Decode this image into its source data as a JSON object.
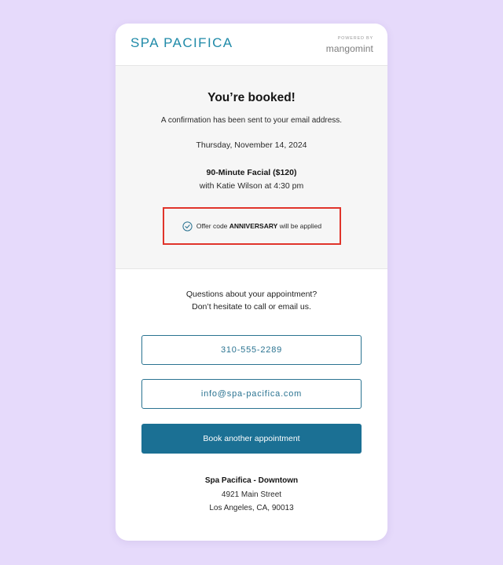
{
  "header": {
    "logo": "SPA PACIFICA",
    "powered_by": "POWERED BY",
    "platform": "mangomint"
  },
  "confirmation": {
    "title": "You’re booked!",
    "subtitle": "A confirmation has been sent to your email address.",
    "date": "Thursday, November 14, 2024",
    "service": "90-Minute Facial ($120)",
    "provider": "with Katie Wilson at 4:30 pm",
    "offer": {
      "prefix": "Offer code ",
      "code": "ANNIVERSARY",
      "suffix": " will be applied",
      "icon": "check-circle-icon",
      "highlight_color": "#e0342b"
    }
  },
  "contact": {
    "question_line1": "Questions about your appointment?",
    "question_line2": "Don’t hesitate to call or email us.",
    "phone": "310-555-2289",
    "email": "info@spa-pacifica.com",
    "book_label": "Book another appointment"
  },
  "location": {
    "name": "Spa Pacifica - Downtown",
    "street": "4921 Main Street",
    "city": "Los Angeles, CA, 90013"
  },
  "colors": {
    "background": "#e6dafb",
    "accent": "#1b7094",
    "logo": "#1f8aa8"
  }
}
